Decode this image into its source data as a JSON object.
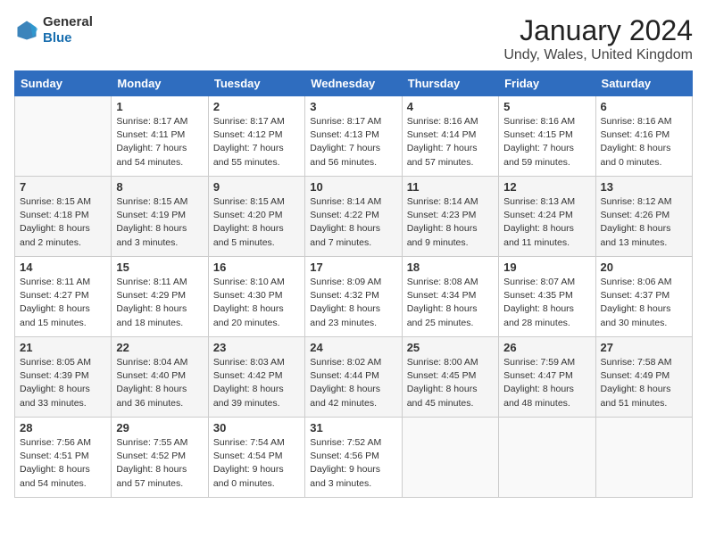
{
  "header": {
    "logo_general": "General",
    "logo_blue": "Blue",
    "month": "January 2024",
    "location": "Undy, Wales, United Kingdom"
  },
  "weekdays": [
    "Sunday",
    "Monday",
    "Tuesday",
    "Wednesday",
    "Thursday",
    "Friday",
    "Saturday"
  ],
  "weeks": [
    [
      {
        "day": "",
        "info": ""
      },
      {
        "day": "1",
        "info": "Sunrise: 8:17 AM\nSunset: 4:11 PM\nDaylight: 7 hours\nand 54 minutes."
      },
      {
        "day": "2",
        "info": "Sunrise: 8:17 AM\nSunset: 4:12 PM\nDaylight: 7 hours\nand 55 minutes."
      },
      {
        "day": "3",
        "info": "Sunrise: 8:17 AM\nSunset: 4:13 PM\nDaylight: 7 hours\nand 56 minutes."
      },
      {
        "day": "4",
        "info": "Sunrise: 8:16 AM\nSunset: 4:14 PM\nDaylight: 7 hours\nand 57 minutes."
      },
      {
        "day": "5",
        "info": "Sunrise: 8:16 AM\nSunset: 4:15 PM\nDaylight: 7 hours\nand 59 minutes."
      },
      {
        "day": "6",
        "info": "Sunrise: 8:16 AM\nSunset: 4:16 PM\nDaylight: 8 hours\nand 0 minutes."
      }
    ],
    [
      {
        "day": "7",
        "info": "Sunrise: 8:15 AM\nSunset: 4:18 PM\nDaylight: 8 hours\nand 2 minutes."
      },
      {
        "day": "8",
        "info": "Sunrise: 8:15 AM\nSunset: 4:19 PM\nDaylight: 8 hours\nand 3 minutes."
      },
      {
        "day": "9",
        "info": "Sunrise: 8:15 AM\nSunset: 4:20 PM\nDaylight: 8 hours\nand 5 minutes."
      },
      {
        "day": "10",
        "info": "Sunrise: 8:14 AM\nSunset: 4:22 PM\nDaylight: 8 hours\nand 7 minutes."
      },
      {
        "day": "11",
        "info": "Sunrise: 8:14 AM\nSunset: 4:23 PM\nDaylight: 8 hours\nand 9 minutes."
      },
      {
        "day": "12",
        "info": "Sunrise: 8:13 AM\nSunset: 4:24 PM\nDaylight: 8 hours\nand 11 minutes."
      },
      {
        "day": "13",
        "info": "Sunrise: 8:12 AM\nSunset: 4:26 PM\nDaylight: 8 hours\nand 13 minutes."
      }
    ],
    [
      {
        "day": "14",
        "info": "Sunrise: 8:11 AM\nSunset: 4:27 PM\nDaylight: 8 hours\nand 15 minutes."
      },
      {
        "day": "15",
        "info": "Sunrise: 8:11 AM\nSunset: 4:29 PM\nDaylight: 8 hours\nand 18 minutes."
      },
      {
        "day": "16",
        "info": "Sunrise: 8:10 AM\nSunset: 4:30 PM\nDaylight: 8 hours\nand 20 minutes."
      },
      {
        "day": "17",
        "info": "Sunrise: 8:09 AM\nSunset: 4:32 PM\nDaylight: 8 hours\nand 23 minutes."
      },
      {
        "day": "18",
        "info": "Sunrise: 8:08 AM\nSunset: 4:34 PM\nDaylight: 8 hours\nand 25 minutes."
      },
      {
        "day": "19",
        "info": "Sunrise: 8:07 AM\nSunset: 4:35 PM\nDaylight: 8 hours\nand 28 minutes."
      },
      {
        "day": "20",
        "info": "Sunrise: 8:06 AM\nSunset: 4:37 PM\nDaylight: 8 hours\nand 30 minutes."
      }
    ],
    [
      {
        "day": "21",
        "info": "Sunrise: 8:05 AM\nSunset: 4:39 PM\nDaylight: 8 hours\nand 33 minutes."
      },
      {
        "day": "22",
        "info": "Sunrise: 8:04 AM\nSunset: 4:40 PM\nDaylight: 8 hours\nand 36 minutes."
      },
      {
        "day": "23",
        "info": "Sunrise: 8:03 AM\nSunset: 4:42 PM\nDaylight: 8 hours\nand 39 minutes."
      },
      {
        "day": "24",
        "info": "Sunrise: 8:02 AM\nSunset: 4:44 PM\nDaylight: 8 hours\nand 42 minutes."
      },
      {
        "day": "25",
        "info": "Sunrise: 8:00 AM\nSunset: 4:45 PM\nDaylight: 8 hours\nand 45 minutes."
      },
      {
        "day": "26",
        "info": "Sunrise: 7:59 AM\nSunset: 4:47 PM\nDaylight: 8 hours\nand 48 minutes."
      },
      {
        "day": "27",
        "info": "Sunrise: 7:58 AM\nSunset: 4:49 PM\nDaylight: 8 hours\nand 51 minutes."
      }
    ],
    [
      {
        "day": "28",
        "info": "Sunrise: 7:56 AM\nSunset: 4:51 PM\nDaylight: 8 hours\nand 54 minutes."
      },
      {
        "day": "29",
        "info": "Sunrise: 7:55 AM\nSunset: 4:52 PM\nDaylight: 8 hours\nand 57 minutes."
      },
      {
        "day": "30",
        "info": "Sunrise: 7:54 AM\nSunset: 4:54 PM\nDaylight: 9 hours\nand 0 minutes."
      },
      {
        "day": "31",
        "info": "Sunrise: 7:52 AM\nSunset: 4:56 PM\nDaylight: 9 hours\nand 3 minutes."
      },
      {
        "day": "",
        "info": ""
      },
      {
        "day": "",
        "info": ""
      },
      {
        "day": "",
        "info": ""
      }
    ]
  ]
}
